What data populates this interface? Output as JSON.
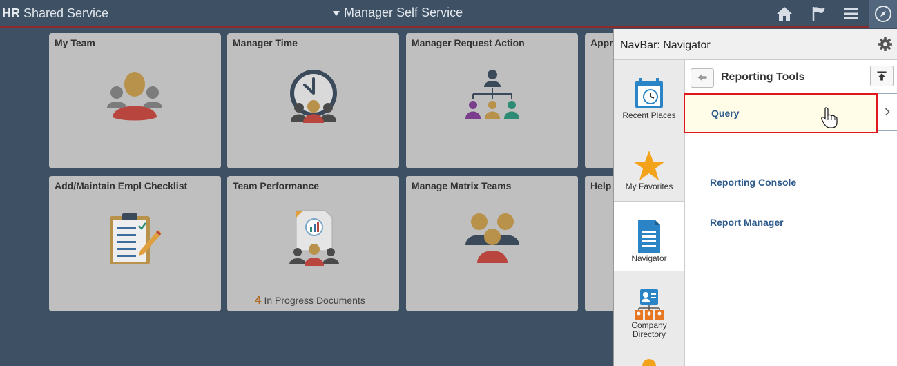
{
  "header": {
    "brand_bold": "HR",
    "brand_rest": " Shared Service",
    "title": "Manager Self Service",
    "icons": [
      "home-icon",
      "flag-icon",
      "menu-icon",
      "navbar-compass-icon"
    ]
  },
  "tiles": [
    {
      "title": "My Team",
      "icon": "team-people-icon"
    },
    {
      "title": "Manager Time",
      "icon": "clock-people-icon"
    },
    {
      "title": "Manager Request Action",
      "icon": "org-chart-icon"
    },
    {
      "title": "Appr",
      "icon": "approvals-icon"
    },
    {
      "title": "Add/Maintain Empl Checklist",
      "icon": "clipboard-checklist-icon"
    },
    {
      "title": "Team Performance",
      "icon": "performance-doc-icon",
      "count": "4",
      "count_label": "In Progress Documents"
    },
    {
      "title": "Manage Matrix Teams",
      "icon": "matrix-people-icon"
    },
    {
      "title": "Help",
      "icon": "help-icon"
    }
  ],
  "navbar": {
    "title": "NavBar: Navigator",
    "side_items": [
      {
        "label": "Recent Places",
        "icon": "recent-places-icon"
      },
      {
        "label": "My Favorites",
        "icon": "star-icon"
      },
      {
        "label": "Navigator",
        "icon": "navigator-doc-icon"
      },
      {
        "label_line1": "Company",
        "label_line2": "Directory",
        "icon": "company-directory-icon"
      }
    ],
    "breadcrumb": "Reporting Tools",
    "items": [
      {
        "label": "Query"
      },
      {
        "label": "Reporting Console"
      },
      {
        "label": "Report Manager"
      }
    ]
  },
  "colors": {
    "background": "#3e5064",
    "tile": "#bfbfbf",
    "selected_border": "#e0171d",
    "link": "#2e5b8b",
    "count": "#b06f2a"
  }
}
